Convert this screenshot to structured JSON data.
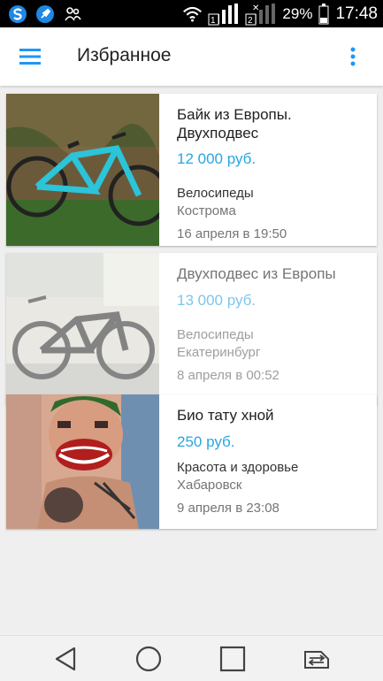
{
  "status_bar": {
    "battery": "29%",
    "time": "17:48",
    "icons": [
      "s-app-icon",
      "rocket-icon",
      "people-icon",
      "wifi-icon",
      "signal-sim1-icon",
      "signal-sim2-icon",
      "battery-icon"
    ]
  },
  "app_bar": {
    "title": "Избранное"
  },
  "colors": {
    "price": "#29a6e0",
    "accent": "#2196f3"
  },
  "favorites": [
    {
      "title": "Байк из Европы. Двухподвес",
      "price": "12 000 руб.",
      "category": "Велосипеды",
      "city": "Кострома",
      "date": "16 апреля в 19:50",
      "image": "teal-bicycle-photo"
    },
    {
      "title": "Двухподвес из Европы",
      "price": "13 000 руб.",
      "category": "Велосипеды",
      "city": "Екатеринбург",
      "date": "8 апреля в 00:52",
      "image": "black-bicycle-photo"
    },
    {
      "title": "Био тату хной",
      "price": "250 руб.",
      "category": "Красота и здоровье",
      "city": "Хабаровск",
      "date": "9 апреля в 23:08",
      "image": "face-tattoo-photo"
    }
  ],
  "nav_bar": {
    "icons": [
      "back-icon",
      "home-icon",
      "recents-icon",
      "sim-switch-icon"
    ]
  }
}
